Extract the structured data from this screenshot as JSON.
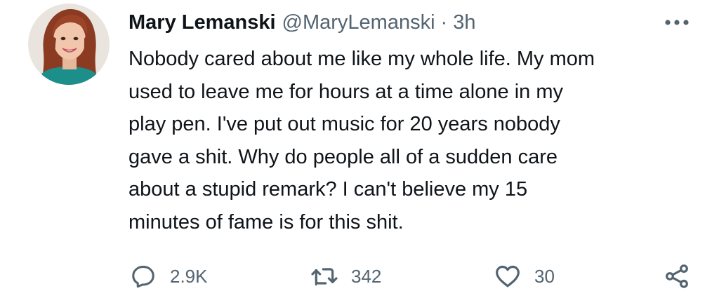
{
  "author": {
    "display_name": "Mary Lemanski",
    "handle": "@MaryLemanski",
    "separator": "·",
    "timestamp": "3h",
    "avatar_icon": "profile-photo"
  },
  "tweet": {
    "text": "Nobody cared about me like my whole life. My mom\nused to leave me for hours at a time alone in my\nplay pen. I've put out music for 20 years nobody\ngave a shit. Why do people all of a sudden care\nabout a stupid remark? I can't believe my 15\nminutes of fame is for this shit."
  },
  "actions": {
    "reply": {
      "icon": "reply-icon",
      "count": "2.9K"
    },
    "retweet": {
      "icon": "retweet-icon",
      "count": "342"
    },
    "like": {
      "icon": "heart-icon",
      "count": "30"
    },
    "share": {
      "icon": "share-icon"
    }
  },
  "colors": {
    "text_primary": "#0f1419",
    "text_secondary": "#536471",
    "background": "#ffffff"
  }
}
